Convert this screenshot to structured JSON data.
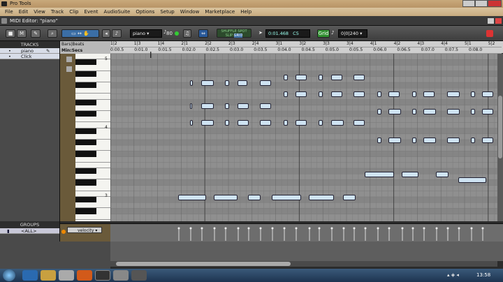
{
  "window": {
    "title": "Pro Tools"
  },
  "menu": [
    "File",
    "Edit",
    "View",
    "Track",
    "Clip",
    "Event",
    "AudioSuite",
    "Options",
    "Setup",
    "Window",
    "Marketplace",
    "Help"
  ],
  "editor": {
    "title": "MIDI Editor: \"piano\""
  },
  "toolbar": {
    "track_name": "piano",
    "velocity_value": "80",
    "mode_shuffle": "SHUFFLE",
    "mode_spot": "SPOT",
    "mode_slip": "SLIP",
    "mode_grid": "GRID",
    "counter_main": "0:01.468",
    "counter_note": "C5",
    "grid_label": "Grid",
    "grid_value": "0|0|240"
  },
  "tracks_panel": {
    "header": "TRACKS",
    "tracks": [
      {
        "name": "piano"
      },
      {
        "name": "Click"
      }
    ]
  },
  "groups_panel": {
    "header": "GROUPS",
    "items": [
      {
        "name": "<ALL>"
      }
    ]
  },
  "rulers": {
    "bars_label": "Bars|Beats",
    "minsecs_label": "Min:Secs",
    "bars_ticks": [
      "1|2",
      "1|3",
      "1|4",
      "2|1",
      "2|2",
      "2|3",
      "2|4",
      "3|1",
      "3|2",
      "3|3",
      "3|4",
      "4|1",
      "4|2",
      "4|3",
      "4|4",
      "5|1",
      "5|2"
    ],
    "minsecs_ticks": [
      "0:00.5",
      "0:01.0",
      "0:01.5",
      "0:02.0",
      "0:02.5",
      "0:03.0",
      "0:03.5",
      "0:04.0",
      "0:04.5",
      "0:05.0",
      "0:05.5",
      "0:06.0",
      "0:06.5",
      "0:07.0",
      "0:07.5",
      "0:08.0"
    ]
  },
  "keyboard_labels": {
    "c5": "5",
    "c4": "4",
    "c3": "3"
  },
  "velocity_lane": {
    "label": "velocity"
  },
  "notes": [
    {
      "row": 4,
      "start": 272,
      "len": 4
    },
    {
      "row": 4,
      "start": 288,
      "len": 18
    },
    {
      "row": 4,
      "start": 322,
      "len": 6
    },
    {
      "row": 4,
      "start": 340,
      "len": 14
    },
    {
      "row": 4,
      "start": 372,
      "len": 16
    },
    {
      "row": 3,
      "start": 406,
      "len": 6
    },
    {
      "row": 3,
      "start": 423,
      "len": 16
    },
    {
      "row": 3,
      "start": 456,
      "len": 6
    },
    {
      "row": 3,
      "start": 474,
      "len": 16
    },
    {
      "row": 3,
      "start": 506,
      "len": 16
    },
    {
      "row": 6,
      "start": 406,
      "len": 6
    },
    {
      "row": 6,
      "start": 423,
      "len": 16
    },
    {
      "row": 6,
      "start": 456,
      "len": 6
    },
    {
      "row": 6,
      "start": 474,
      "len": 16
    },
    {
      "row": 6,
      "start": 506,
      "len": 16
    },
    {
      "row": 6,
      "start": 540,
      "len": 6
    },
    {
      "row": 6,
      "start": 556,
      "len": 16
    },
    {
      "row": 6,
      "start": 590,
      "len": 6
    },
    {
      "row": 6,
      "start": 606,
      "len": 16
    },
    {
      "row": 6,
      "start": 640,
      "len": 18
    },
    {
      "row": 6,
      "start": 674,
      "len": 6
    },
    {
      "row": 6,
      "start": 690,
      "len": 16
    },
    {
      "row": 8,
      "start": 272,
      "len": 3
    },
    {
      "row": 8,
      "start": 288,
      "len": 18
    },
    {
      "row": 8,
      "start": 322,
      "len": 6
    },
    {
      "row": 8,
      "start": 340,
      "len": 16
    },
    {
      "row": 8,
      "start": 372,
      "len": 16
    },
    {
      "row": 9,
      "start": 540,
      "len": 6
    },
    {
      "row": 9,
      "start": 556,
      "len": 18
    },
    {
      "row": 9,
      "start": 590,
      "len": 6
    },
    {
      "row": 9,
      "start": 606,
      "len": 18
    },
    {
      "row": 9,
      "start": 640,
      "len": 18
    },
    {
      "row": 9,
      "start": 674,
      "len": 6
    },
    {
      "row": 9,
      "start": 690,
      "len": 16
    },
    {
      "row": 11,
      "start": 272,
      "len": 4
    },
    {
      "row": 11,
      "start": 288,
      "len": 18
    },
    {
      "row": 11,
      "start": 322,
      "len": 6
    },
    {
      "row": 11,
      "start": 340,
      "len": 16
    },
    {
      "row": 11,
      "start": 372,
      "len": 16
    },
    {
      "row": 11,
      "start": 406,
      "len": 6
    },
    {
      "row": 11,
      "start": 423,
      "len": 16
    },
    {
      "row": 11,
      "start": 456,
      "len": 6
    },
    {
      "row": 11,
      "start": 474,
      "len": 18
    },
    {
      "row": 11,
      "start": 506,
      "len": 16
    },
    {
      "row": 14,
      "start": 540,
      "len": 6
    },
    {
      "row": 14,
      "start": 556,
      "len": 18
    },
    {
      "row": 14,
      "start": 590,
      "len": 6
    },
    {
      "row": 14,
      "start": 606,
      "len": 18
    },
    {
      "row": 14,
      "start": 640,
      "len": 18
    },
    {
      "row": 14,
      "start": 674,
      "len": 6
    },
    {
      "row": 14,
      "start": 690,
      "len": 16
    },
    {
      "row": 20,
      "start": 522,
      "len": 42
    },
    {
      "row": 20,
      "start": 575,
      "len": 24
    },
    {
      "row": 20,
      "start": 624,
      "len": 18
    },
    {
      "row": 21,
      "start": 656,
      "len": 40
    },
    {
      "row": 24,
      "start": 255,
      "len": 40
    },
    {
      "row": 24,
      "start": 306,
      "len": 34
    },
    {
      "row": 24,
      "start": 355,
      "len": 18
    },
    {
      "row": 24,
      "start": 389,
      "len": 42
    },
    {
      "row": 24,
      "start": 442,
      "len": 36
    },
    {
      "row": 24,
      "start": 491,
      "len": 18
    }
  ],
  "taskbar": {
    "clock": "13:58"
  }
}
